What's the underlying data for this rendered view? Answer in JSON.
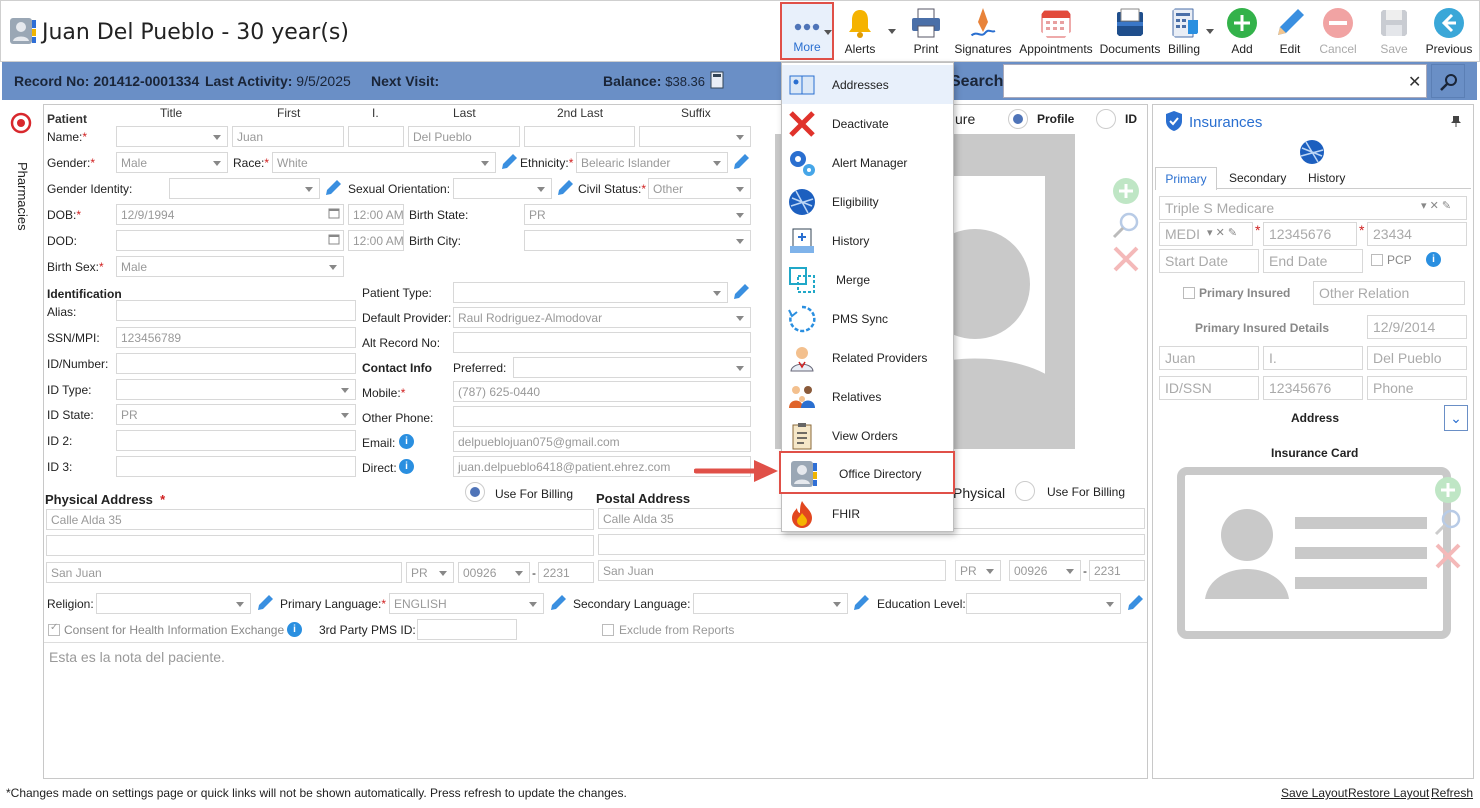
{
  "header": {
    "title": "Juan Del Pueblo - 30 year(s)"
  },
  "toolbar": {
    "more": "More",
    "alerts": "Alerts",
    "print": "Print",
    "signatures": "Signatures",
    "appointments": "Appointments",
    "documents": "Documents",
    "billing": "Billing",
    "add": "Add",
    "edit": "Edit",
    "cancel": "Cancel",
    "save": "Save",
    "previous": "Previous"
  },
  "infobar": {
    "record_label": "Record No:",
    "record_value": "201412-0001334",
    "activity_label": "Last Activity:",
    "activity_value": "9/5/2025",
    "next_visit_label": "Next Visit:",
    "balance_label": "Balance:",
    "balance_value": "$38.36",
    "search_label": "Search:"
  },
  "sidebar": {
    "pharmacies": "Pharmacies"
  },
  "name_headers": {
    "patient": "Patient",
    "title": "Title",
    "first": "First",
    "initial": "I.",
    "last": "Last",
    "second_last": "2nd Last",
    "suffix": "Suffix"
  },
  "form": {
    "name_label": "Name:",
    "first": "Juan",
    "last": "Del Pueblo",
    "gender_label": "Gender:",
    "gender": "Male",
    "race_label": "Race:",
    "race": "White",
    "ethnicity_label": "Ethnicity:",
    "ethnicity": "Belearic Islander",
    "gender_identity_label": "Gender Identity:",
    "sexual_orientation_label": "Sexual Orientation:",
    "civil_status_label": "Civil Status:",
    "civil_status": "Other",
    "dob_label": "DOB:",
    "dob": "12/9/1994",
    "dob_time": "12:00 AM",
    "birth_state_label": "Birth State:",
    "birth_state": "PR",
    "dod_label": "DOD:",
    "dod_time": "12:00 AM",
    "birth_city_label": "Birth City:",
    "birth_sex_label": "Birth Sex:",
    "birth_sex": "Male",
    "identification": "Identification",
    "alias_label": "Alias:",
    "ssn_label": "SSN/MPI:",
    "ssn": "123456789",
    "idnum_label": "ID/Number:",
    "idtype_label": "ID Type:",
    "idstate_label": "ID State:",
    "idstate": "PR",
    "id2_label": "ID 2:",
    "id3_label": "ID 3:",
    "patient_type_label": "Patient Type:",
    "default_provider_label": "Default Provider:",
    "default_provider": "Raul Rodriguez-Almodovar",
    "alt_record_label": "Alt Record No:",
    "contact_info": "Contact Info",
    "preferred_label": "Preferred:",
    "mobile_label": "Mobile:",
    "mobile": "(787) 625-0440",
    "other_phone_label": "Other Phone:",
    "email_label": "Email:",
    "email": "delpueblojuan075@gmail.com",
    "direct_label": "Direct:",
    "direct": "juan.delpueblo6418@patient.ehrez.com",
    "physical_address": "Physical Address",
    "use_for_billing": "Use For Billing",
    "postal_address": "Postal Address",
    "physical_short": "Physical",
    "phys_line1": "Calle Alda 35",
    "phys_city": "San Juan",
    "phys_state": "PR",
    "phys_zip": "00926",
    "phys_zip4": "2231",
    "postal_line1": "Calle Alda 35",
    "postal_city": "San Juan",
    "postal_state": "PR",
    "postal_zip": "00926",
    "postal_zip4": "2231",
    "religion_label": "Religion:",
    "primary_language_label": "Primary Language:",
    "primary_language": "ENGLISH",
    "secondary_language_label": "Secondary Language:",
    "education_label": "Education Level:",
    "consent_label": "Consent for Health Information Exchange",
    "third_party_label": "3rd Party PMS ID:",
    "exclude_label": "Exclude from Reports",
    "notes": "Esta es la nota del paciente."
  },
  "photo": {
    "picture_label": "ure",
    "profile": "Profile",
    "id": "ID"
  },
  "menu": {
    "items": [
      "Addresses",
      "Deactivate",
      "Alert Manager",
      "Eligibility",
      "History",
      "Merge",
      "PMS Sync",
      "Related Providers",
      "Relatives",
      "View Orders",
      "Office Directory",
      "FHIR"
    ]
  },
  "insurance": {
    "title": "Insurances",
    "tabs": [
      "Primary",
      "Secondary",
      "History"
    ],
    "plan": "Triple S Medicare",
    "plan_type": "MEDI",
    "member_id": "12345676",
    "group": "23434",
    "start_date": "Start Date",
    "end_date": "End Date",
    "pcp": "PCP",
    "primary_insured": "Primary Insured",
    "other_relation": "Other Relation",
    "primary_insured_details": "Primary Insured Details",
    "pi_dob": "12/9/2014",
    "pi_first": "Juan",
    "pi_initial": "I.",
    "pi_last": "Del Pueblo",
    "pi_idssn": "ID/SSN",
    "pi_id": "12345676",
    "pi_phone": "Phone",
    "address": "Address",
    "insurance_card": "Insurance Card"
  },
  "footer": {
    "note": "*Changes made on settings page or quick links will not be shown automatically. Press refresh to update the changes.",
    "save_layout": "Save Layout",
    "restore_layout": "Restore Layout",
    "refresh": "Refresh"
  },
  "colors": {
    "infobar": "#6a8fc6",
    "highlight": "#e05048",
    "accent_blue": "#2a6fd0"
  }
}
